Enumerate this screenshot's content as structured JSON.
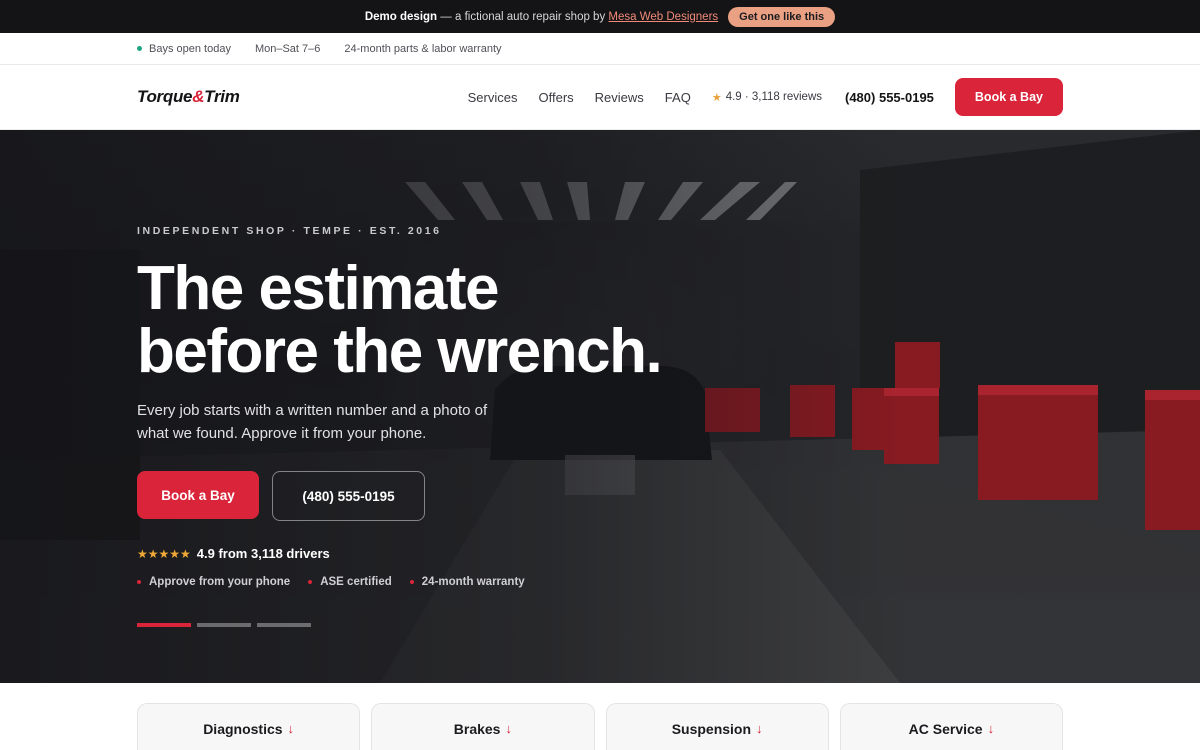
{
  "demo_bar": {
    "lead": "Demo design",
    "text": "— a fictional auto repair shop by",
    "link": "Mesa Web Designers",
    "cta": "Get one like this"
  },
  "info_strip": [
    "Bays open today",
    "Mon–Sat 7–6",
    "24-month parts & labor warranty"
  ],
  "header": {
    "logo_a": "Torque",
    "logo_amp": "&",
    "logo_b": "Trim",
    "nav": [
      "Services",
      "Offers",
      "Reviews",
      "FAQ"
    ],
    "rating": "4.9 · 3,118 reviews",
    "phone": "(480) 555-0195",
    "book": "Book a Bay"
  },
  "hero": {
    "eyebrow": "INDEPENDENT SHOP · TEMPE · EST. 2016",
    "headline_1": "The estimate",
    "headline_2": "before the wrench.",
    "sub": "Every job starts with a written number and a photo of what we found. Approve it from your phone.",
    "primary_cta": "Book a Bay",
    "phone_cta": "(480) 555-0195",
    "stars": "★★★★★",
    "rating": "4.9 from 3,118 drivers",
    "badges": [
      "Approve from your phone",
      "ASE certified",
      "24-month warranty"
    ],
    "slides_total": 3,
    "slide_active": 1
  },
  "services": [
    {
      "label": "Diagnostics",
      "arrow": "↓"
    },
    {
      "label": "Brakes",
      "arrow": "↓"
    },
    {
      "label": "Suspension",
      "arrow": "↓"
    },
    {
      "label": "AC Service",
      "arrow": "↓"
    }
  ],
  "colors": {
    "brand_red": "#d9243a",
    "star": "#e8a13a",
    "open_dot": "#1ea683",
    "dark": "#141416"
  }
}
